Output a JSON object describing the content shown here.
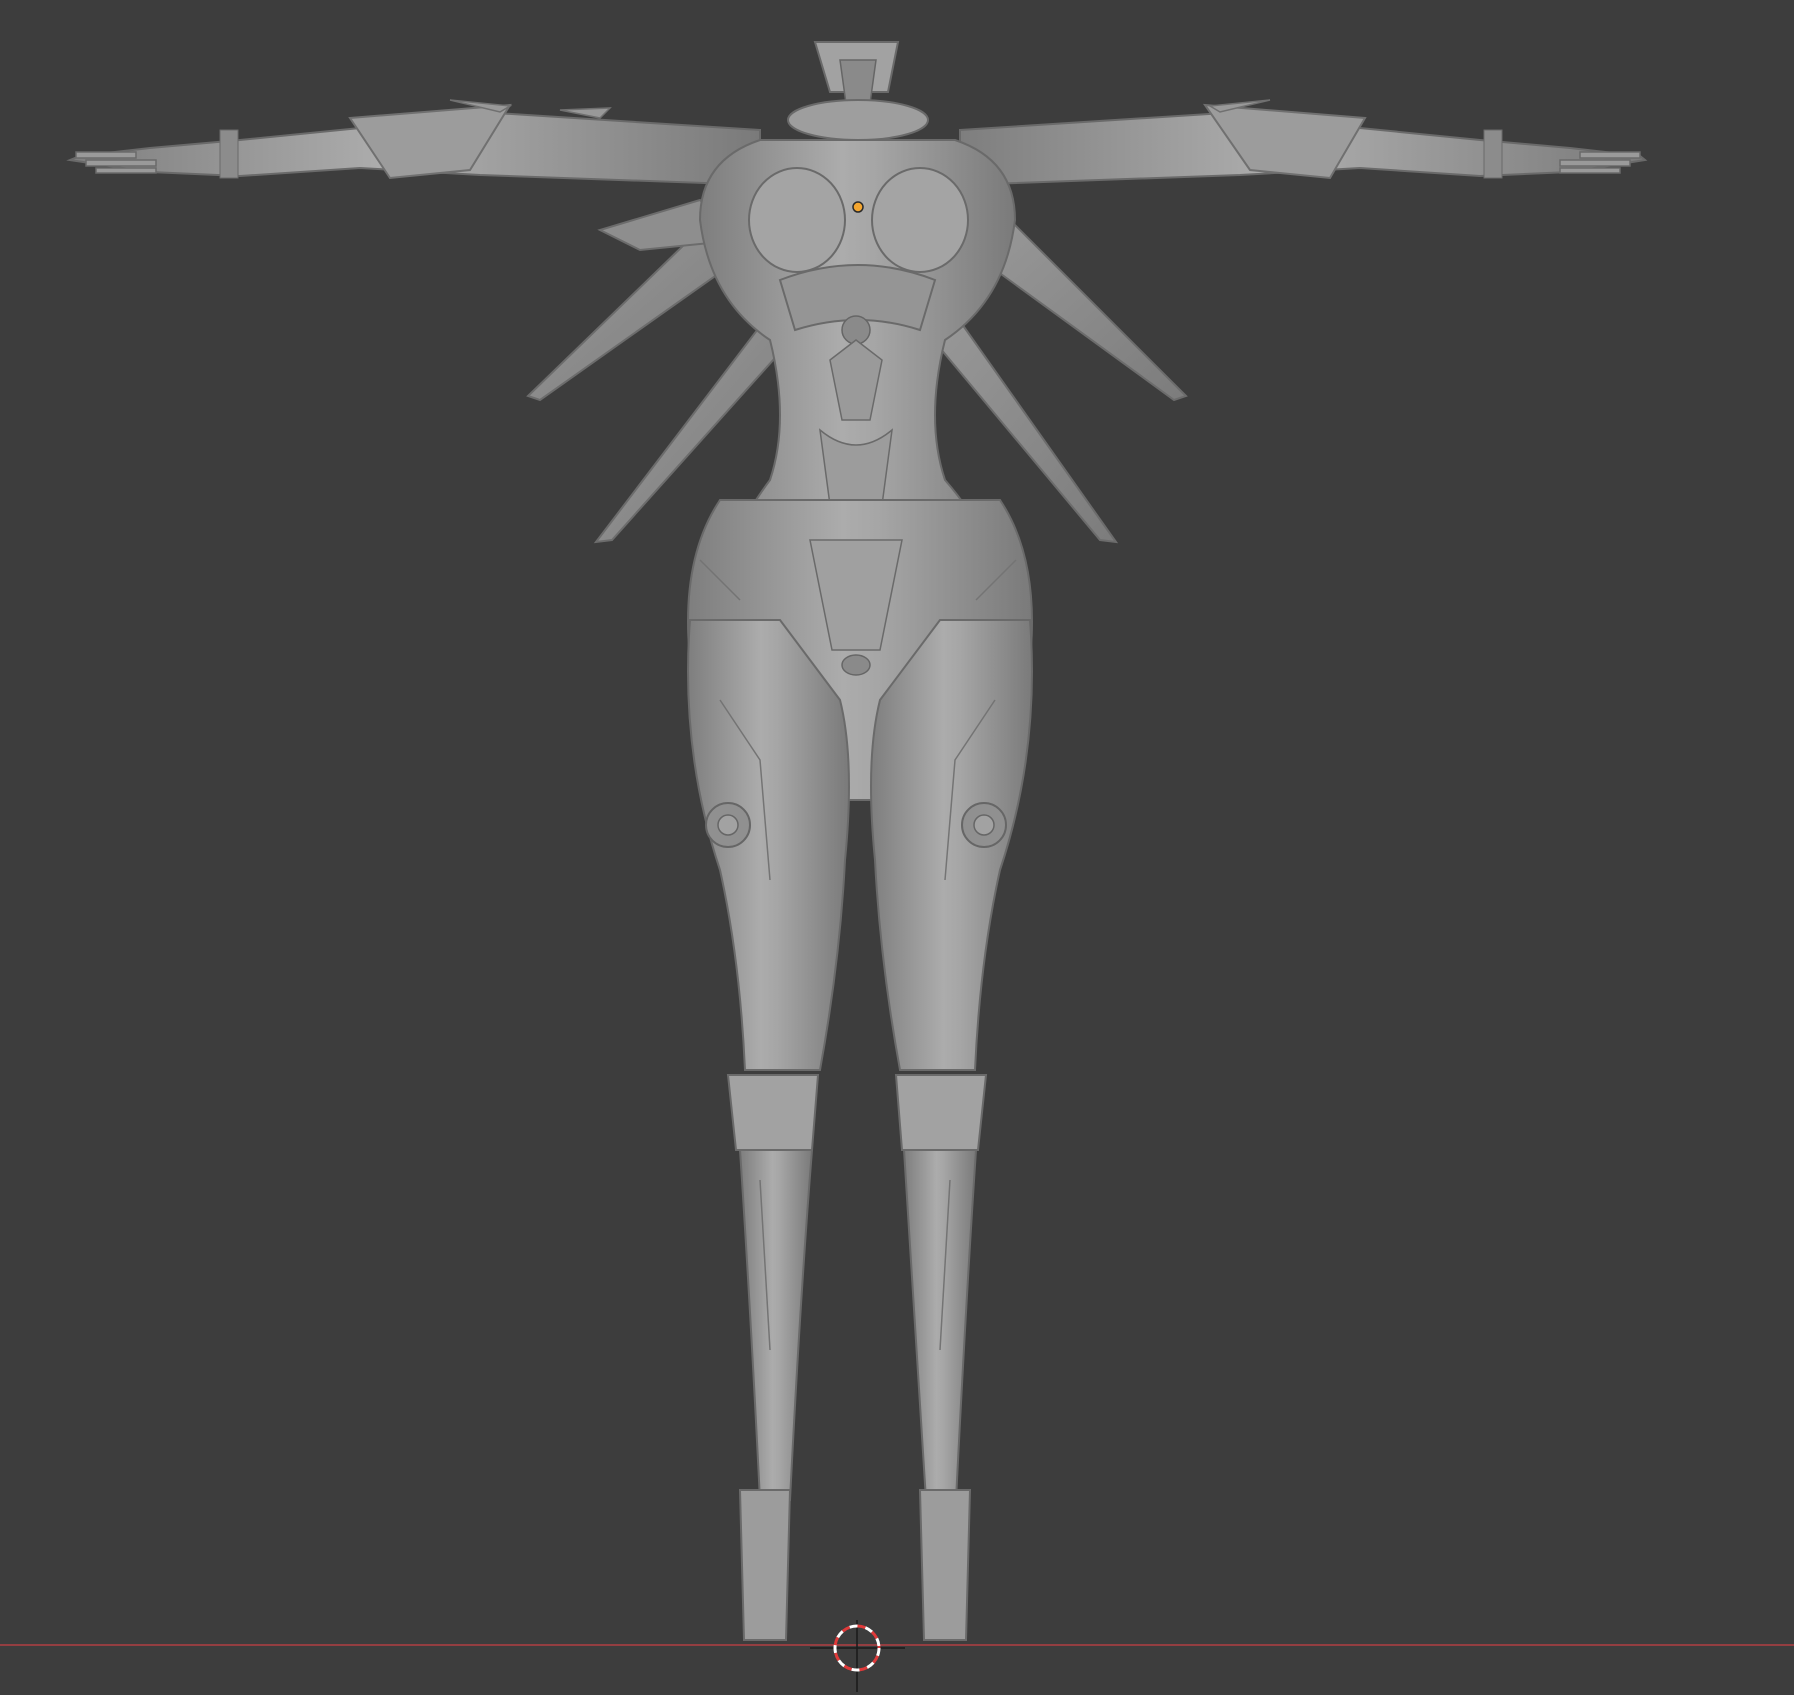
{
  "viewport": {
    "background_color": "#3d3d3d",
    "x_axis_color": "#b23f43",
    "model_color": "#9a9a9a",
    "model_shadow_color": "#6f6f6f",
    "model_highlight_color": "#b4b4b4",
    "origin_marker_color": "#f4a630",
    "cursor_colors": [
      "#ffffff",
      "#e03a3a"
    ]
  },
  "scene": {
    "object": "armored-female-figure-t-pose",
    "view": "front-orthographic",
    "icons": [
      "3d-cursor-icon",
      "object-origin-icon"
    ]
  }
}
